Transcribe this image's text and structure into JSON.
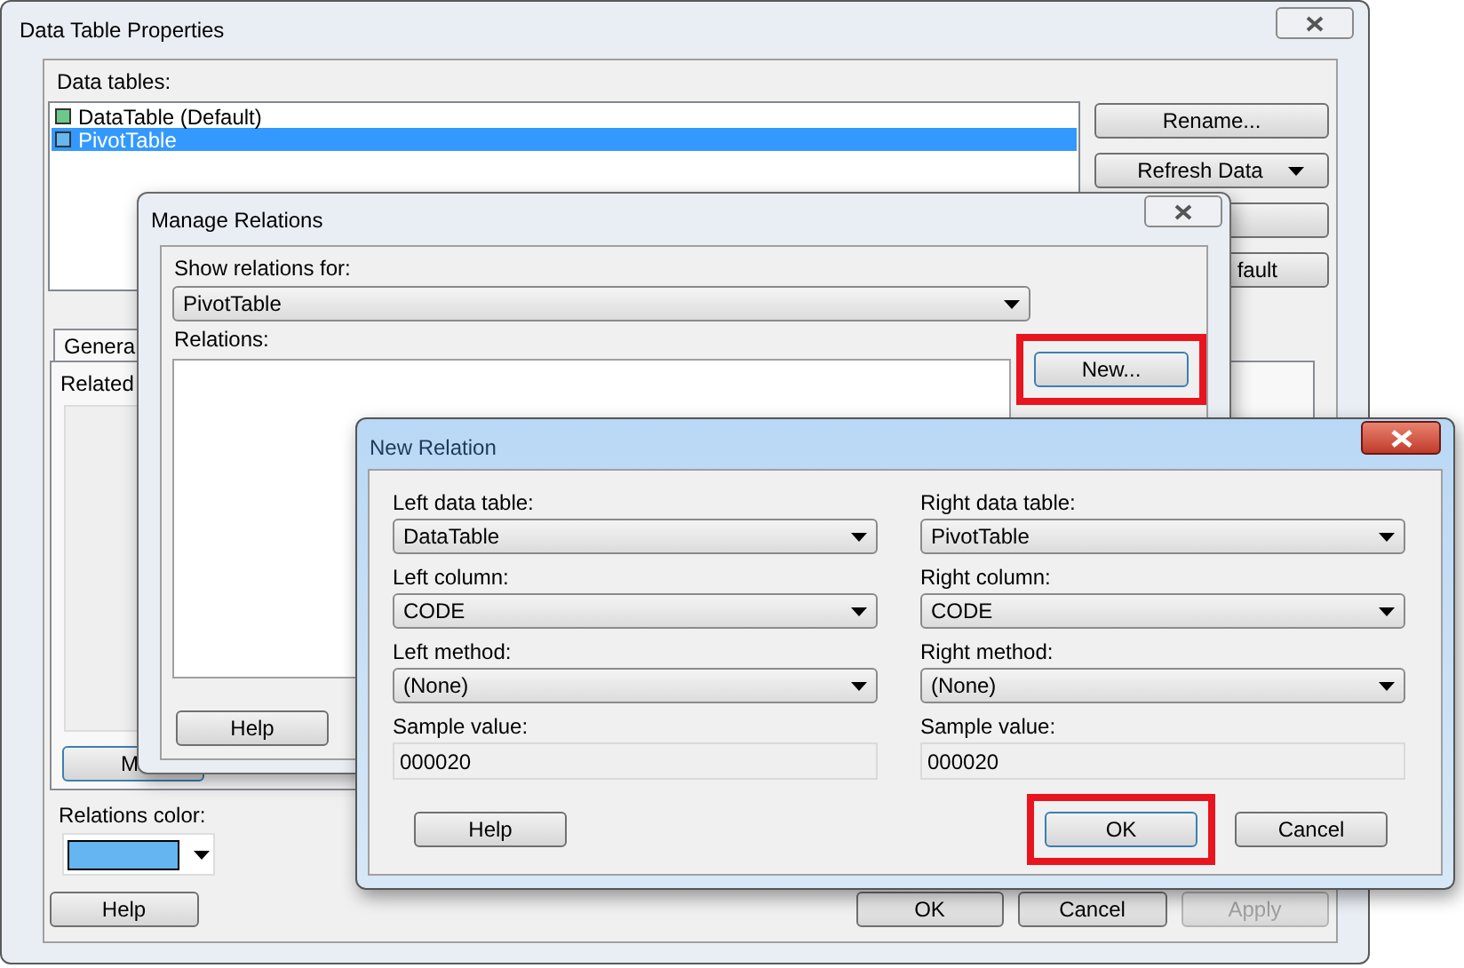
{
  "main_window": {
    "title": "Data Table Properties",
    "data_tables_label": "Data tables:",
    "data_tables": [
      {
        "name": "DataTable (Default)",
        "color": "#6cc98a",
        "selected": false
      },
      {
        "name": "PivotTable",
        "color": "#66b8f0",
        "selected": true
      }
    ],
    "side_buttons": [
      {
        "label": "Rename...",
        "kind": "plain"
      },
      {
        "label": "Refresh Data",
        "kind": "split"
      },
      {
        "kind": "blank"
      },
      {
        "label": "fault",
        "kind": "plain"
      }
    ],
    "tabs": [
      {
        "label": "Genera",
        "selected": true
      }
    ],
    "related_label": "Related",
    "manage_button": "M",
    "relations_color_label": "Relations color:",
    "relations_swatch": {
      "color": "#64b5f0"
    },
    "footer_buttons": [
      {
        "label": "Help",
        "disabled": false
      },
      {
        "label": "OK",
        "disabled": false
      },
      {
        "label": "Cancel",
        "disabled": false
      },
      {
        "label": "Apply",
        "disabled": true
      }
    ]
  },
  "manage_relations": {
    "title": "Manage Relations",
    "show_label": "Show relations for:",
    "show_value": "PivotTable",
    "relations_label": "Relations:",
    "new_button": {
      "label": "New...",
      "highlighted": true
    },
    "help_button": "Help"
  },
  "new_relation": {
    "title": "New Relation",
    "left": [
      {
        "label": "Left data table:",
        "value": "DataTable",
        "kind": "select"
      },
      {
        "label": "Left column:",
        "value": "CODE",
        "kind": "select"
      },
      {
        "label": "Left method:",
        "value": "(None)",
        "kind": "select"
      },
      {
        "label": "Sample value:",
        "value": "000020",
        "kind": "readonly"
      }
    ],
    "right": [
      {
        "label": "Right data table:",
        "value": "PivotTable",
        "kind": "select"
      },
      {
        "label": "Right column:",
        "value": "CODE",
        "kind": "select"
      },
      {
        "label": "Right method:",
        "value": "(None)",
        "kind": "select"
      },
      {
        "label": "Sample value:",
        "value": "000020",
        "kind": "readonly"
      }
    ],
    "buttons": [
      {
        "label": "Help",
        "highlighted": false
      },
      {
        "label": "OK",
        "highlighted": true
      },
      {
        "label": "Cancel",
        "highlighted": false
      }
    ]
  }
}
